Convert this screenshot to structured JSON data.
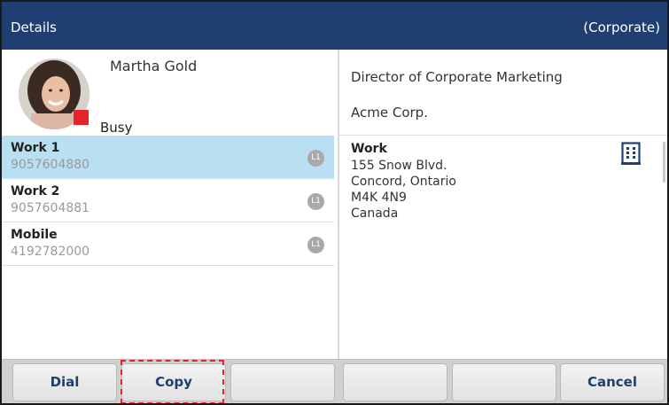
{
  "header": {
    "title": "Details",
    "directory": "(Corporate)"
  },
  "contact": {
    "name": "Martha Gold",
    "status": "Busy",
    "status_color": "#e8222a",
    "job_title": "Director of Corporate Marketing",
    "company": "Acme Corp."
  },
  "phones": [
    {
      "label": "Work 1",
      "number": "9057604880",
      "line": "L1",
      "selected": true
    },
    {
      "label": "Work 2",
      "number": "9057604881",
      "line": "L1",
      "selected": false
    },
    {
      "label": "Mobile",
      "number": "4192782000",
      "line": "L1",
      "selected": false
    }
  ],
  "address": {
    "label": "Work",
    "line1": "155 Snow Blvd.",
    "line2": "Concord, Ontario",
    "line3": "M4K 4N9",
    "line4": "Canada",
    "icon": "building-icon"
  },
  "softkeys": {
    "dial": "Dial",
    "copy": "Copy",
    "cancel": "Cancel"
  },
  "colors": {
    "header": "#1f3f73",
    "selected_row": "#b8dff2",
    "accent": "#e8222a"
  }
}
